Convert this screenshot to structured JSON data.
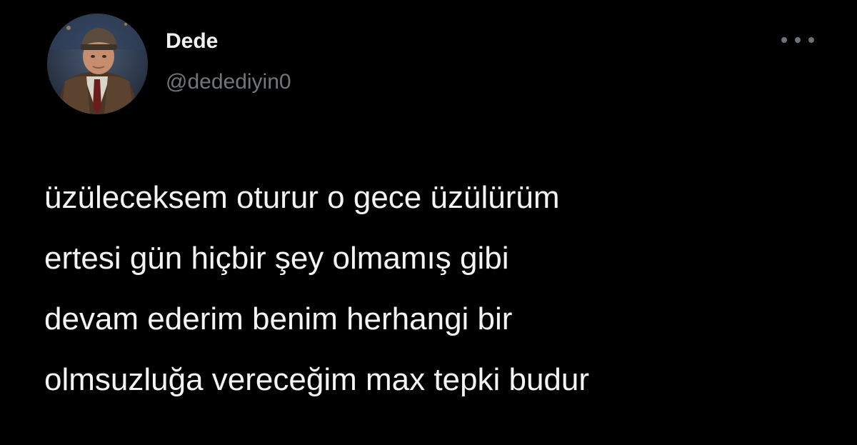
{
  "tweet": {
    "author": {
      "display_name": "Dede",
      "handle": "@dedediyin0",
      "avatar": "profile-photo-old-man-in-cap-and-coat"
    },
    "more_icon": "more-horizontal-icon",
    "text_lines": [
      "üzüleceksem oturur o gece üzülürüm",
      "ertesi gün hiçbir şey olmamış gibi",
      "devam ederim benim herhangi bir",
      "olmsuzluğa vereceğim max tepki budur"
    ]
  },
  "colors": {
    "background": "#000000",
    "text": "#f4f4f4",
    "secondary_text": "#71767b"
  }
}
